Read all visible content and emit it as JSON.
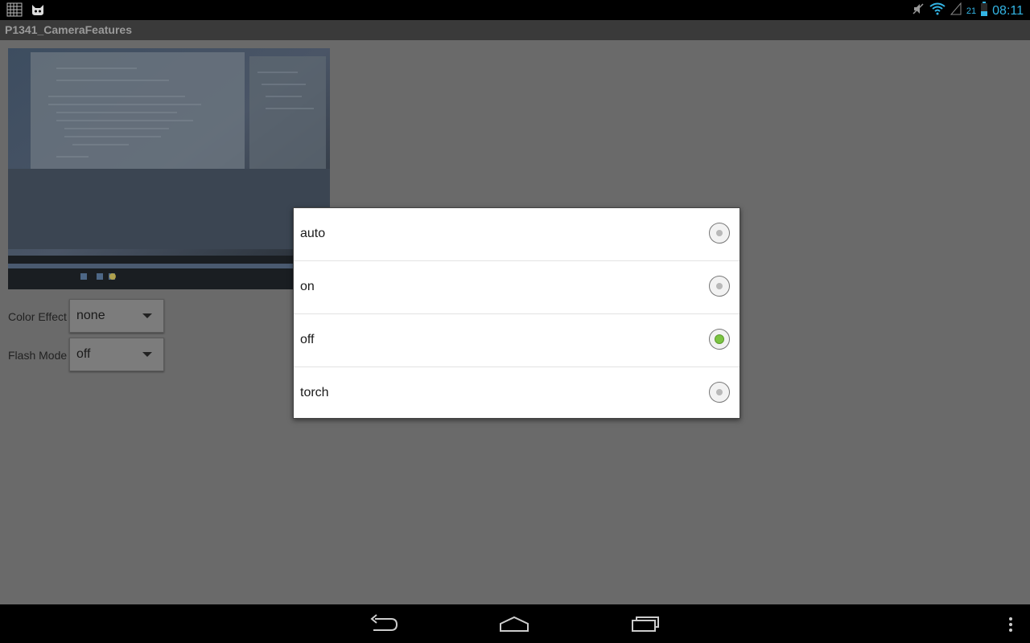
{
  "status_bar": {
    "battery_level": "21",
    "time": "08:11",
    "icons": [
      "gallery-grid-icon",
      "cat-icon",
      "mute-icon",
      "wifi-icon",
      "signal-icon",
      "battery-icon"
    ]
  },
  "app": {
    "title": "P1341_CameraFeatures"
  },
  "main": {
    "color_effect": {
      "label": "Color Effect",
      "value": "none"
    },
    "flash_mode": {
      "label": "Flash Mode",
      "value": "off"
    }
  },
  "dialog": {
    "options": [
      {
        "label": "auto",
        "checked": false
      },
      {
        "label": "on",
        "checked": false
      },
      {
        "label": "off",
        "checked": true
      },
      {
        "label": "torch",
        "checked": false
      }
    ]
  },
  "navbar": {
    "icons": [
      "back-icon",
      "home-icon",
      "recent-apps-icon",
      "overflow-menu-icon"
    ]
  },
  "colors": {
    "accent": "#33b5e5",
    "radio_checked": "#7bc442"
  }
}
